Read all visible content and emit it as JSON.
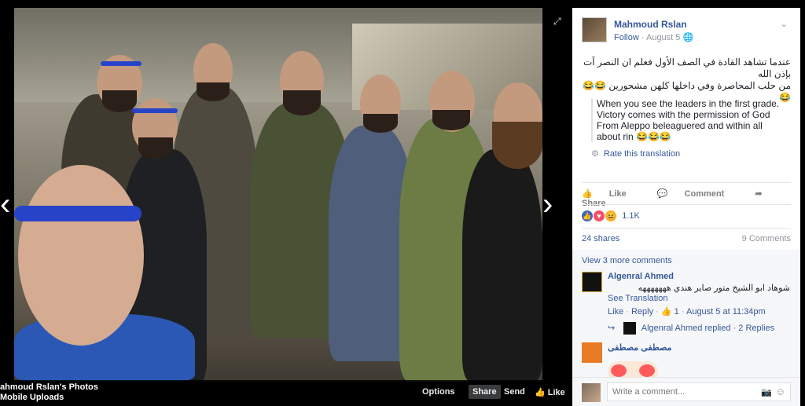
{
  "post": {
    "author": "Mahmoud Rslan",
    "follow_label": "Follow",
    "date": "August 5",
    "arabic_text": "عندما تشاهد القادة في الصف الأول فعلم ان النصر آت بإذن الله\nمن حلب المحاصرة وفي داخلها كلهن مشحورين 😂😂😂",
    "translation": "When you see the leaders in the first grade. Victory comes with the permission of God From Aleppo beleaguered and within all about rin 😂😂😂",
    "rate_label": "Rate this translation"
  },
  "actions": {
    "like": "Like",
    "comment": "Comment",
    "share": "Share"
  },
  "stats": {
    "reactions_count": "1.1K",
    "shares": "24 shares",
    "comments": "9 Comments"
  },
  "comments": {
    "view_more": "View 3 more comments",
    "c1": {
      "name": "Algenral Ahmed",
      "text": "شوهاد ابو الشيخ متور صاير هندي هههههههه",
      "see_translation": "See Translation",
      "like": "Like",
      "reply": "Reply",
      "likes": "1",
      "time": "August 5 at 11:34pm",
      "replied_name": "Algenral Ahmed",
      "replied_text": "replied",
      "replies": "2 Replies"
    },
    "c2": {
      "name": "مصطفى مصطفى"
    },
    "write_placeholder": "Write a comment..."
  },
  "photo": {
    "album_line1": "ahmoud Rslan's Photos",
    "album_line2": "Mobile Uploads",
    "options": "Options",
    "share": "Share",
    "send": "Send",
    "like": "Like"
  },
  "colors": {
    "link": "#365899",
    "headband": "#2744c8"
  },
  "icons": [
    "expand-icon",
    "chevron-left-icon",
    "chevron-right-icon",
    "chevron-down-icon",
    "globe-icon",
    "gear-icon",
    "like-icon",
    "comment-icon",
    "share-icon",
    "camera-icon",
    "smiley-icon"
  ]
}
